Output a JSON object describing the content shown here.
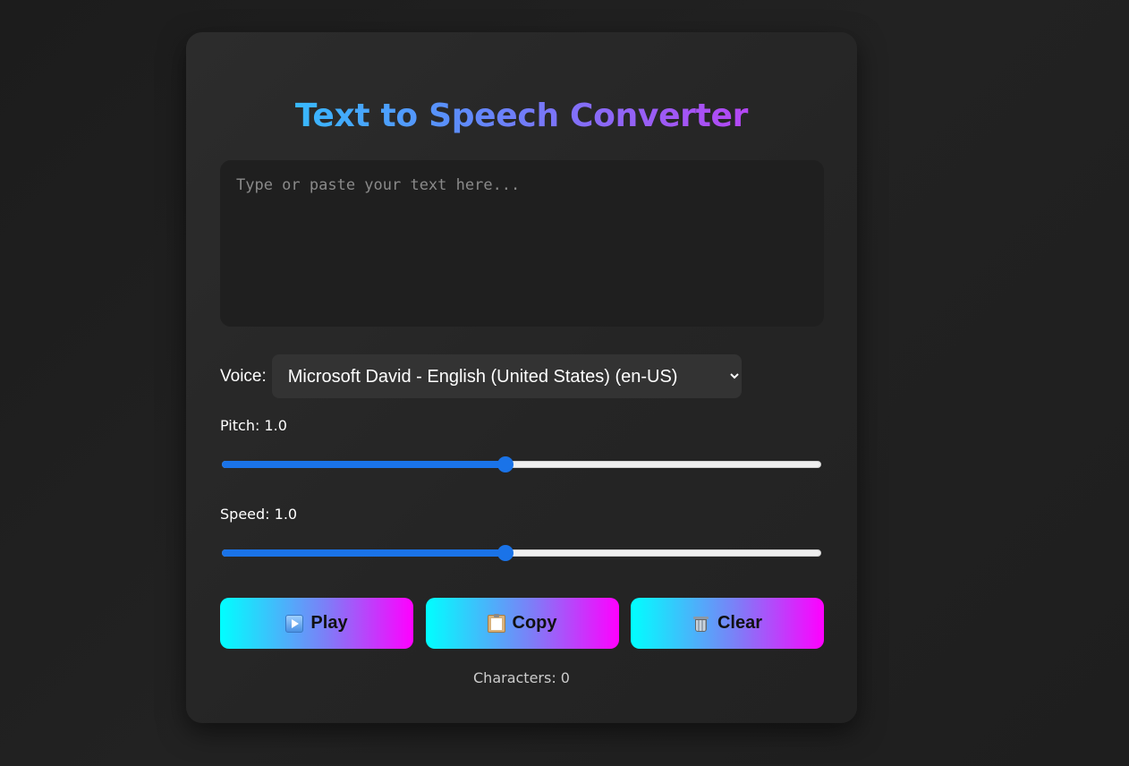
{
  "app": {
    "title": "Text to Speech Converter"
  },
  "input": {
    "value": "",
    "placeholder": "Type or paste your text here..."
  },
  "voice": {
    "label": "Voice:",
    "selected": "Microsoft David - English (United States) (en-US)"
  },
  "pitch": {
    "label": "Pitch: 1.0",
    "value": 1.0,
    "min": 0.1,
    "max": 2.0
  },
  "speed": {
    "label": "Speed: 1.0",
    "value": 1.0,
    "min": 0.1,
    "max": 2.0
  },
  "buttons": {
    "play": {
      "label": "Play",
      "icon": "play-icon"
    },
    "copy": {
      "label": "Copy",
      "icon": "clipboard-icon"
    },
    "clear": {
      "label": "Clear",
      "icon": "trash-icon"
    }
  },
  "status": {
    "characters": "Characters: 0"
  },
  "colors": {
    "button_gradient_start": "#00ffff",
    "button_gradient_end": "#ff00ff",
    "slider_accent": "#1a73e8",
    "title_gradient_start": "#1fd6ff",
    "title_gradient_end": "#d32df4"
  }
}
